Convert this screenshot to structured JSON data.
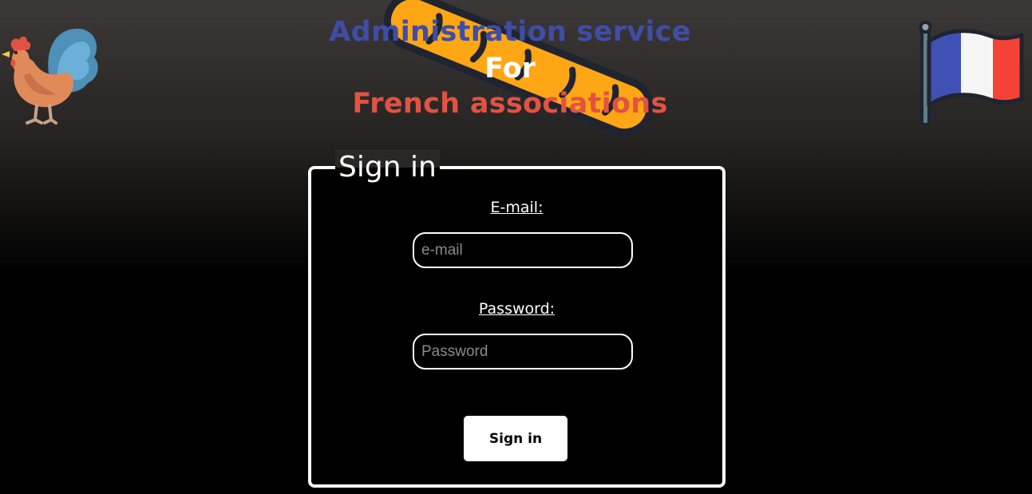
{
  "header": {
    "title_line1": "Administration service",
    "title_line2": "For",
    "title_line3": "French associations",
    "icons": {
      "left": "rooster-icon",
      "center": "baguette-icon",
      "right": "french-flag-icon"
    }
  },
  "signin": {
    "legend": "Sign in",
    "email_label": "E-mail:",
    "email_placeholder": "e-mail",
    "email_value": "",
    "password_label": "Password:",
    "password_placeholder": "Password",
    "password_value": "",
    "submit_label": "Sign in"
  },
  "colors": {
    "title_blue": "#3e4ea6",
    "title_white": "#ffffff",
    "title_red": "#e25242",
    "flag_blue": "#3f51b5",
    "flag_red": "#f44336",
    "baguette": "#ffa615"
  }
}
